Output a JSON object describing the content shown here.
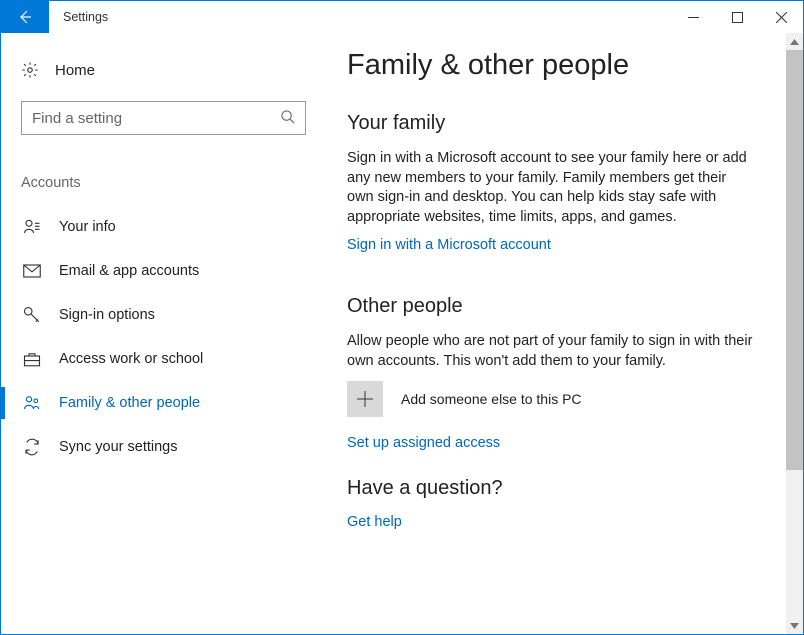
{
  "titlebar": {
    "title": "Settings"
  },
  "sidebar": {
    "home_label": "Home",
    "search_placeholder": "Find a setting",
    "section_header": "Accounts",
    "items": [
      {
        "label": "Your info",
        "icon": "user",
        "active": false
      },
      {
        "label": "Email & app accounts",
        "icon": "mail",
        "active": false
      },
      {
        "label": "Sign-in options",
        "icon": "key",
        "active": false
      },
      {
        "label": "Access work or school",
        "icon": "briefcase",
        "active": false
      },
      {
        "label": "Family & other people",
        "icon": "family",
        "active": true
      },
      {
        "label": "Sync your settings",
        "icon": "sync",
        "active": false
      }
    ]
  },
  "content": {
    "page_title": "Family & other people",
    "family": {
      "heading": "Your family",
      "body": "Sign in with a Microsoft account to see your family here or add any new members to your family. Family members get their own sign-in and desktop. You can help kids stay safe with appropriate websites, time limits, apps, and games.",
      "link": "Sign in with a Microsoft account"
    },
    "other": {
      "heading": "Other people",
      "body": "Allow people who are not part of your family to sign in with their own accounts. This won't add them to your family.",
      "add_label": "Add someone else to this PC",
      "assigned_link": "Set up assigned access"
    },
    "question": {
      "heading": "Have a question?",
      "link": "Get help"
    }
  }
}
